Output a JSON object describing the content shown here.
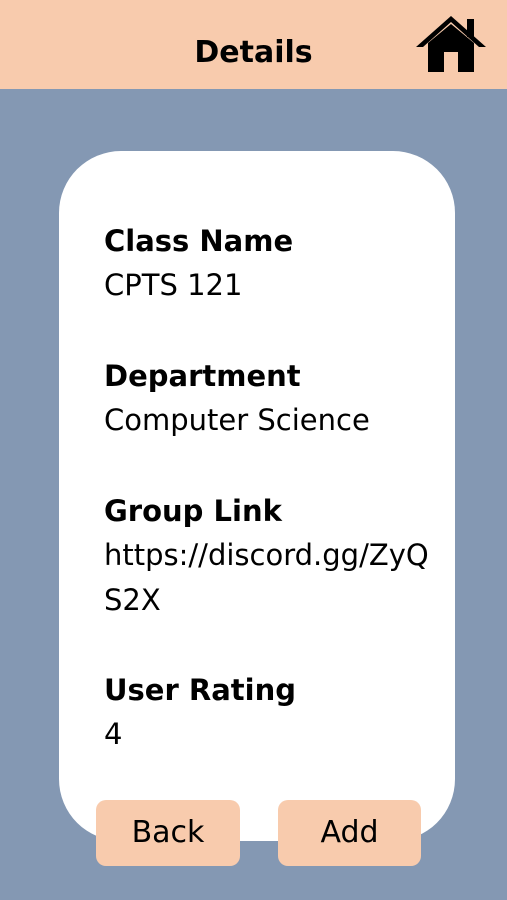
{
  "header": {
    "title": "Details",
    "home_icon": "home-icon"
  },
  "details": {
    "class_name_label": "Class Name",
    "class_name_value": "CPTS 121",
    "department_label": "Department",
    "department_value": "Computer Science",
    "group_link_label": "Group Link",
    "group_link_value": "https://discord.gg/ZyQS2X",
    "user_rating_label": "User Rating",
    "user_rating_value": "4"
  },
  "actions": {
    "back_label": "Back",
    "add_label": "Add"
  },
  "colors": {
    "header_bg": "#f8cbad",
    "page_bg": "#8498b3",
    "card_bg": "#ffffff",
    "button_bg": "#f8cbad"
  }
}
